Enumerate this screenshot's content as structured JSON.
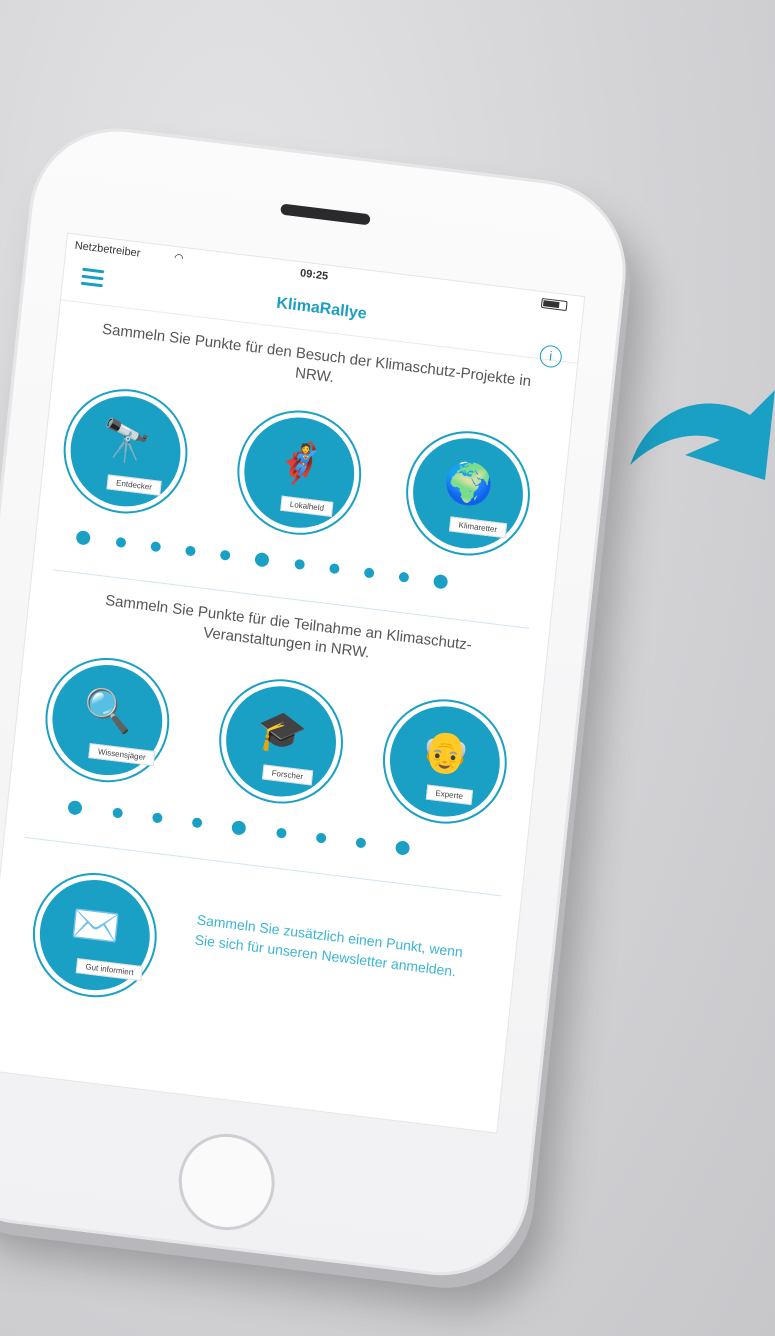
{
  "colors": {
    "accent": "#1aa0c4",
    "arrow": "#1aa0c4",
    "phone_frame": "#f4f4f6",
    "screen_bg": "#ffffff"
  },
  "status_bar": {
    "carrier": "Netzbetreiber",
    "time": "09:25"
  },
  "app": {
    "title": "KlimaRallye",
    "menu_icon": "hamburger-menu-icon",
    "info_icon": "info-icon",
    "info_glyph": "i"
  },
  "section_projects": {
    "intro": "Sammeln Sie Punkte für den Besuch der Klimaschutz-Projekte in NRW.",
    "badges": [
      {
        "label": "Entdecker",
        "icon": "binoculars-icon"
      },
      {
        "label": "Lokalheld",
        "icon": "superhero-icon"
      },
      {
        "label": "Klimaretter",
        "icon": "globe-icon"
      }
    ],
    "progress_dots": 11
  },
  "section_events": {
    "intro": "Sammeln Sie Punkte für die Teilnahme an Klimaschutz-Veranstaltungen in NRW.",
    "badges": [
      {
        "label": "Wissensjäger",
        "icon": "magnifier-icon"
      },
      {
        "label": "Forscher",
        "icon": "graduate-icon"
      },
      {
        "label": "Experte",
        "icon": "professor-icon"
      }
    ],
    "progress_dots": 9
  },
  "section_newsletter": {
    "badge_label": "Gut informiert",
    "badge_icon": "envelope-newspaper-icon",
    "text": "Sammeln Sie zusätzlich einen Punkt, wenn Sie sich für unseren Newsletter anmelden."
  }
}
